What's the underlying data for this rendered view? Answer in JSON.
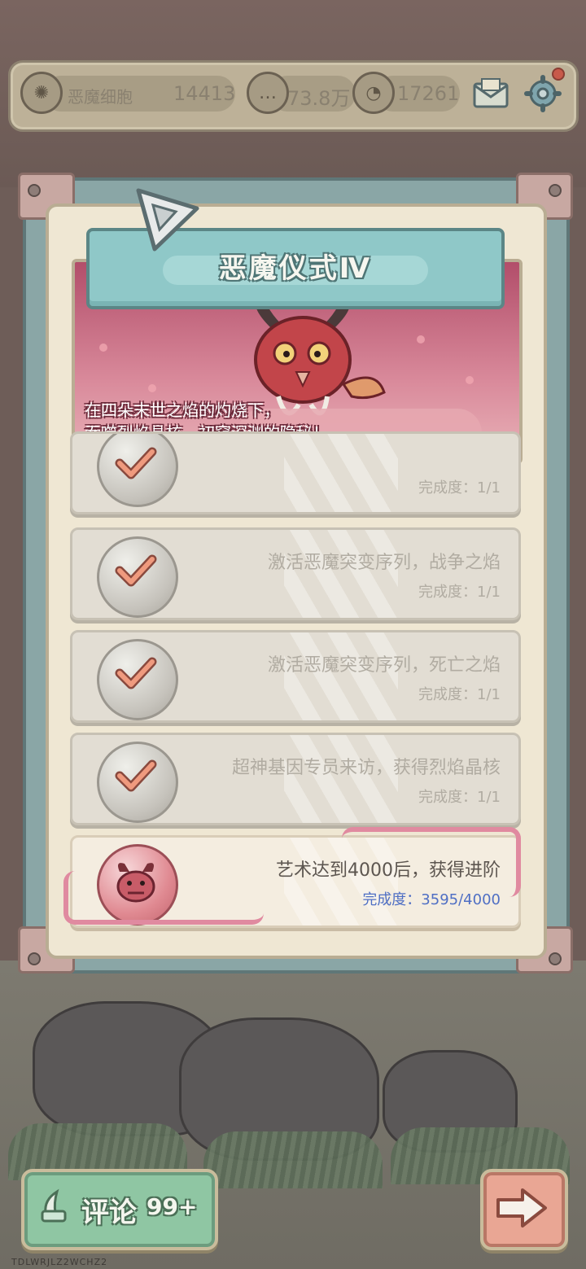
{
  "topbar": {
    "resource_label": "恶魔细胞",
    "resource_value": "14413",
    "currency_1": "73.8万",
    "currency_2": "17261",
    "icons": [
      "demon-cell-icon",
      "bubble-icon",
      "bubble-icon",
      "mail-icon",
      "gear-icon"
    ]
  },
  "panel": {
    "title": "恶魔仪式Ⅳ",
    "description_line1": "在四朵末世之焰的灼烧下，",
    "description_line2": "吞噬烈焰晶核，初窥深渊的隐秘！"
  },
  "tasks": [
    {
      "title": "",
      "progress": "完成度：1/1",
      "done": true
    },
    {
      "title": "激活恶魔突变序列，战争之焰",
      "progress": "完成度：1/1",
      "done": true
    },
    {
      "title": "激活恶魔突变序列，死亡之焰",
      "progress": "完成度：1/1",
      "done": true
    },
    {
      "title": "超神基因专员来访，获得烈焰晶核",
      "progress": "完成度：1/1",
      "done": true
    },
    {
      "title": "艺术达到4000后，获得进阶",
      "progress": "完成度：3595/4000",
      "done": false,
      "progress_value": 3595,
      "progress_max": 4000
    }
  ],
  "bottom": {
    "comment_label": "评论",
    "comment_count": "99+",
    "next_icon": "arrow-right-icon",
    "watermark": "TDLWRJLZ2WCHZ2"
  },
  "colors": {
    "panel_teal": "#8aa6a6",
    "progress_blue": "#4f6fc4",
    "banner_pink": "#b24e6a"
  }
}
